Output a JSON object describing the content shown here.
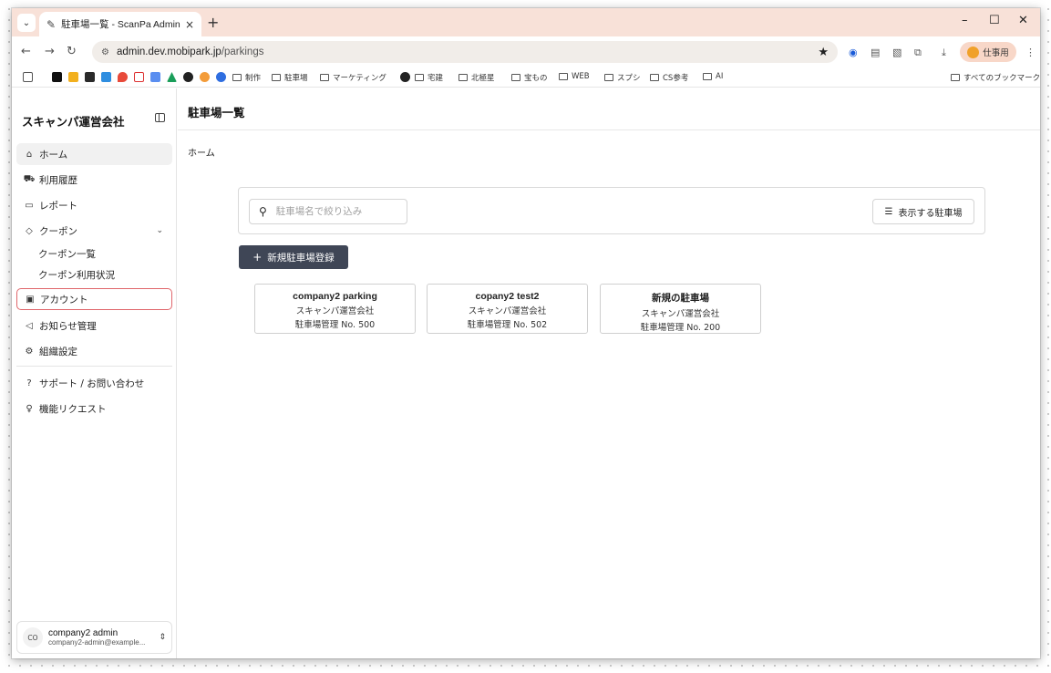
{
  "browser": {
    "tab_title": "駐車場一覧 - ScanPa Admin",
    "url_host": "admin.dev.mobipark.jp",
    "url_path": "/parkings",
    "profile_label": "仕事用",
    "bookmarks": [
      "制作",
      "駐車場",
      "マーケティング",
      "宅建",
      "北極星",
      "宝もの",
      "WEB",
      "スプシ",
      "CS参考",
      "AI"
    ],
    "all_bookmarks": "すべてのブックマーク"
  },
  "sidebar": {
    "org_name": "スキャンパ運営会社",
    "items": [
      {
        "label": "ホーム",
        "icon": "home-icon"
      },
      {
        "label": "利用履歴",
        "icon": "car-icon"
      },
      {
        "label": "レポート",
        "icon": "report-icon"
      },
      {
        "label": "クーポン",
        "icon": "coupon-icon"
      },
      {
        "label": "アカウント",
        "icon": "account-icon"
      },
      {
        "label": "お知らせ管理",
        "icon": "megaphone-icon"
      },
      {
        "label": "組織設定",
        "icon": "gear-icon"
      },
      {
        "label": "サポート / お問い合わせ",
        "icon": "help-icon"
      },
      {
        "label": "機能リクエスト",
        "icon": "lightbulb-icon"
      }
    ],
    "coupon_sub": [
      "クーポン一覧",
      "クーポン利用状況"
    ],
    "user": {
      "initials": "CO",
      "name": "company2 admin",
      "email": "company2-admin@example..."
    }
  },
  "main": {
    "title": "駐車場一覧",
    "breadcrumb": "ホーム",
    "search_placeholder": "駐車場名で絞り込み",
    "filter_label": "表示する駐車場",
    "add_button": "新規駐車場登録",
    "parkings": [
      {
        "name": "company2 parking",
        "company": "スキャンパ運営会社",
        "number": "駐車場管理 No. 500"
      },
      {
        "name": "copany2 test2",
        "company": "スキャンパ運営会社",
        "number": "駐車場管理 No. 502"
      },
      {
        "name": "新規の駐車場",
        "company": "スキャンパ運営会社",
        "number": "駐車場管理 No. 200"
      }
    ]
  },
  "colors": {
    "tabstrip": "#f8e1d8",
    "primary_button": "#3f4656",
    "highlight_outline": "#e0666b"
  }
}
